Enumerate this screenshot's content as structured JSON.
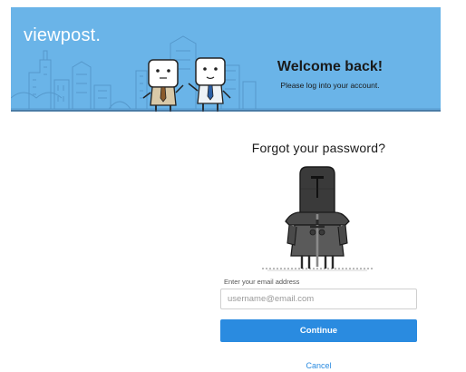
{
  "banner": {
    "logo_text": "viewpost",
    "logo_dot": ".",
    "title": "Welcome back!",
    "subtitle": "Please log into your account.",
    "background_color": "#6ab4e8"
  },
  "form": {
    "title": "Forgot your password?",
    "email_label": "Enter your email address",
    "email_placeholder": "username@email.com",
    "email_value": "",
    "continue_label": "Continue",
    "cancel_label": "Cancel",
    "accent_color": "#2a8be0"
  },
  "illustrations": {
    "banner_characters": "two-cartoon-businessmen-illustration",
    "knight": "knight-with-sword-illustration"
  }
}
